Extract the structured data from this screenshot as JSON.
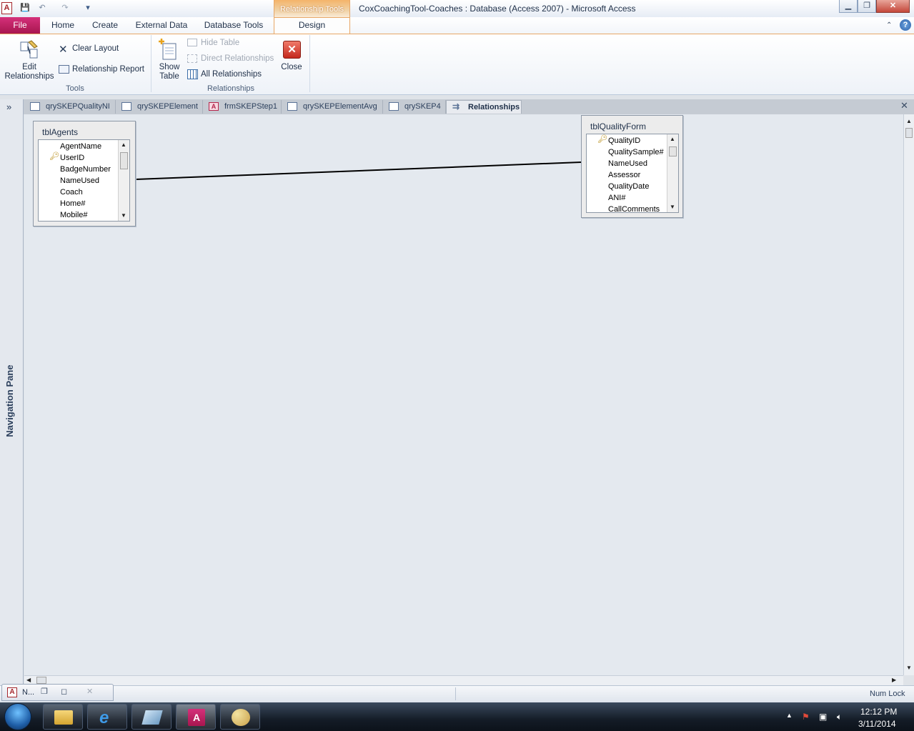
{
  "app": {
    "window_title": "CoxCoachingTool-Coaches : Database (Access 2007)  -  Microsoft Access",
    "logo_letter": "A",
    "contextual_tab_group": "Relationship Tools",
    "window_buttons": {
      "minimize": "▁",
      "restore": "❐",
      "close": "✕"
    }
  },
  "ribbon": {
    "tabs": [
      {
        "label": "File"
      },
      {
        "label": "Home"
      },
      {
        "label": "Create"
      },
      {
        "label": "External Data"
      },
      {
        "label": "Database Tools"
      },
      {
        "label": "Design"
      }
    ],
    "groups": {
      "tools": {
        "label": "Tools",
        "edit_relationships": "Edit Relationships",
        "edit_relationships_l1": "Edit",
        "edit_relationships_l2": "Relationships",
        "clear_layout": "Clear Layout",
        "relationship_report": "Relationship Report"
      },
      "relationships": {
        "label": "Relationships",
        "show_table_l1": "Show",
        "show_table_l2": "Table",
        "hide_table": "Hide Table",
        "direct_relationships": "Direct Relationships",
        "all_relationships": "All Relationships",
        "close": "Close"
      }
    }
  },
  "navigation_pane": {
    "label": "Navigation Pane",
    "toggle": "»"
  },
  "document_tabs": [
    {
      "label": "qrySKEPQualityNI",
      "type": "query"
    },
    {
      "label": "qrySKEPElement",
      "type": "query"
    },
    {
      "label": "frmSKEPStep1",
      "type": "form"
    },
    {
      "label": "qrySKEPElementAvg",
      "type": "query"
    },
    {
      "label": "qrySKEP4",
      "type": "query"
    },
    {
      "label": "Relationships",
      "type": "relationships",
      "active": true
    }
  ],
  "doc_close": "✕",
  "tables": {
    "agents": {
      "name": "tblAgents",
      "fields": [
        "AgentName",
        "UserID",
        "BadgeNumber",
        "NameUsed",
        "Coach",
        "Home#",
        "Mobile#"
      ],
      "key_field": "UserID"
    },
    "quality": {
      "name": "tblQualityForm",
      "fields": [
        "QualityID",
        "QualitySample#",
        "NameUsed",
        "Assessor",
        "QualityDate",
        "ANI#",
        "CallComments"
      ],
      "key_field": "QualityID"
    }
  },
  "status": {
    "num_lock": "Num Lock"
  },
  "mini_window": {
    "label": "N..."
  },
  "taskbar": {
    "time": "12:12 PM",
    "date": "3/11/2014"
  },
  "colors": {
    "file_tab": "#a8164f",
    "context_accent": "#f4b46a",
    "canvas": "#e4e9ef"
  }
}
